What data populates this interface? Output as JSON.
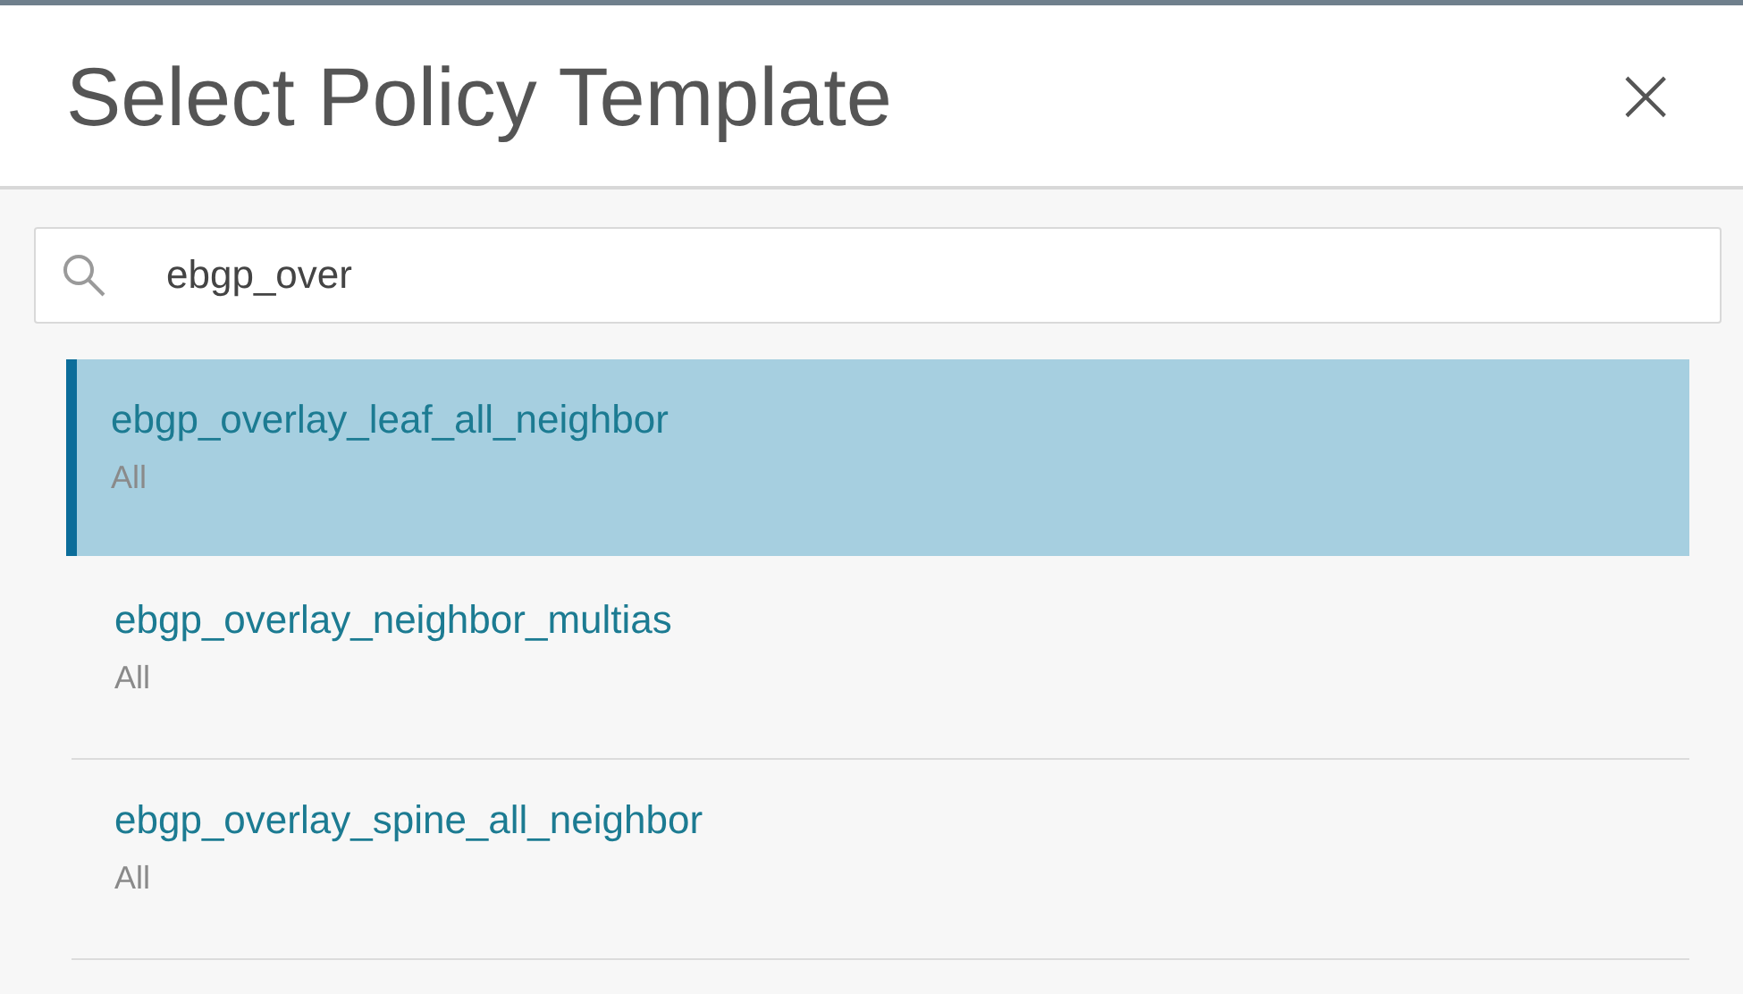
{
  "dialog": {
    "title": "Select Policy Template",
    "close": "×"
  },
  "search": {
    "value": "ebgp_over"
  },
  "templates": [
    {
      "name": "ebgp_overlay_leaf_all_neighbor",
      "scope": "All",
      "selected": true
    },
    {
      "name": "ebgp_overlay_neighbor_multias",
      "scope": "All",
      "selected": false
    },
    {
      "name": "ebgp_overlay_spine_all_neighbor",
      "scope": "All",
      "selected": false
    }
  ]
}
